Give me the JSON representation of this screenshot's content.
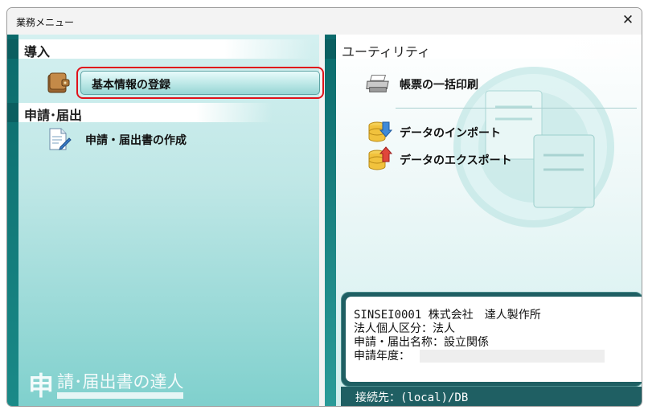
{
  "window": {
    "title": "業務メニュー"
  },
  "left": {
    "section1": {
      "heading": "導入",
      "items": [
        {
          "label": "基本情報の登録"
        }
      ]
    },
    "section2": {
      "heading": "申請･届出",
      "items": [
        {
          "label": "申請・届出書の作成"
        }
      ]
    },
    "brand": {
      "big_char": "申",
      "rest": "請･届出書の達人"
    }
  },
  "right": {
    "heading": "ユーティリティ",
    "items": [
      {
        "label": "帳票の一括印刷"
      },
      {
        "label": "データのインポート"
      },
      {
        "label": "データのエクスポート"
      }
    ],
    "info": {
      "line1": "SINSEI0001 株式会社　達人製作所",
      "line2": "法人個人区分：法人",
      "line3": "申請・届出名称：設立関係",
      "line4": "申請年度："
    },
    "connection": "接続先：(local)/DB"
  },
  "colors": {
    "highlight": "#e0121b",
    "teal_dark": "#0b6a6b",
    "teal_light": "#bfe7e6"
  }
}
